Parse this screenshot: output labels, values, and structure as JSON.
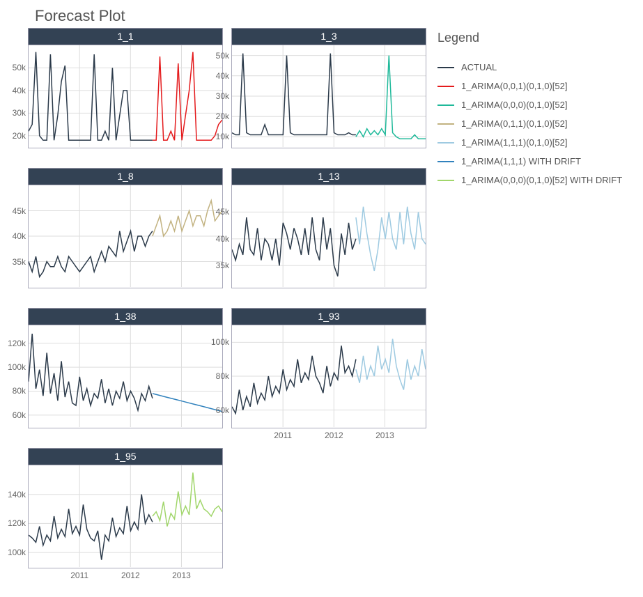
{
  "title": "Forecast Plot",
  "legend_title": "Legend",
  "legend": [
    {
      "label": "ACTUAL",
      "color": "#2b3a4a"
    },
    {
      "label": "1_ARIMA(0,0,1)(0,1,0)[52]",
      "color": "#e41a1c"
    },
    {
      "label": "1_ARIMA(0,0,0)(0,1,0)[52]",
      "color": "#1fb99a"
    },
    {
      "label": "1_ARIMA(0,1,1)(0,1,0)[52]",
      "color": "#c2b280"
    },
    {
      "label": "1_ARIMA(1,1,1)(0,1,0)[52]",
      "color": "#9ecae1"
    },
    {
      "label": "1_ARIMA(1,1,1) WITH DRIFT",
      "color": "#3182bd"
    },
    {
      "label": "1_ARIMA(0,0,0)(0,1,0)[52] WITH DRIFT",
      "color": "#a1d66b"
    }
  ],
  "x_shared": {
    "ticks": [
      "2011",
      "2012",
      "2013"
    ],
    "min": 2010,
    "max": 2013.8
  },
  "chart_data": [
    {
      "title": "1_1",
      "type": "line",
      "ylim": [
        15000,
        60000
      ],
      "yticks": [
        20000,
        30000,
        40000,
        50000
      ],
      "yticklabels": [
        "20k",
        "30k",
        "40k",
        "50k"
      ],
      "xlabel": "",
      "ylabel": "",
      "series": [
        {
          "name": "ACTUAL",
          "color": "#2b3a4a",
          "values": [
            22000,
            25000,
            57000,
            20000,
            18000,
            18000,
            56000,
            18000,
            29000,
            44000,
            51000,
            18000,
            18000,
            18000,
            18000,
            18000,
            18000,
            18000,
            56000,
            18000,
            18000,
            22000,
            18000,
            50000,
            18000,
            29000,
            40000,
            40000,
            18000,
            18000,
            18000,
            18000,
            18000,
            18000,
            18000
          ]
        },
        {
          "name": "1_ARIMA(0,0,1)(0,1,0)[52]",
          "color": "#e41a1c",
          "values": [
            18000,
            18000,
            55000,
            18000,
            18000,
            22000,
            18000,
            52000,
            18000,
            29000,
            40000,
            57000,
            18000,
            18000,
            18000,
            18000,
            18000,
            20000,
            25000,
            27000
          ]
        }
      ]
    },
    {
      "title": "1_3",
      "type": "line",
      "ylim": [
        5000,
        55000
      ],
      "yticks": [
        10000,
        20000,
        30000,
        40000,
        50000
      ],
      "yticklabels": [
        "10k",
        "20k",
        "30k",
        "40k",
        "50k"
      ],
      "xlabel": "",
      "ylabel": "",
      "series": [
        {
          "name": "ACTUAL",
          "color": "#2b3a4a",
          "values": [
            12000,
            11000,
            11000,
            51000,
            12000,
            11000,
            11000,
            11000,
            11000,
            16000,
            11000,
            11000,
            11000,
            11000,
            11000,
            50000,
            12000,
            11000,
            11000,
            11000,
            11000,
            11000,
            11000,
            11000,
            11000,
            11000,
            11000,
            51000,
            12000,
            11000,
            11000,
            11000,
            12000,
            11000,
            11000
          ]
        },
        {
          "name": "1_ARIMA(0,0,0)(0,1,0)[52]",
          "color": "#1fb99a",
          "values": [
            10000,
            13000,
            10000,
            14000,
            11000,
            13000,
            11000,
            14000,
            11000,
            50000,
            12000,
            10000,
            9000,
            9000,
            9000,
            9000,
            11000,
            9000,
            9000,
            9000
          ]
        }
      ]
    },
    {
      "title": "1_8",
      "type": "line",
      "ylim": [
        30000,
        50000
      ],
      "yticks": [
        35000,
        40000,
        45000
      ],
      "yticklabels": [
        "35k",
        "40k",
        "45k"
      ],
      "xlabel": "",
      "ylabel": "",
      "series": [
        {
          "name": "ACTUAL",
          "color": "#2b3a4a",
          "values": [
            35000,
            33000,
            36000,
            32000,
            33000,
            35000,
            34000,
            34000,
            36000,
            34000,
            33000,
            36000,
            35000,
            34000,
            33000,
            34000,
            35000,
            36000,
            33000,
            35000,
            37000,
            35000,
            38000,
            37000,
            36000,
            41000,
            37000,
            39000,
            41000,
            37000,
            40000,
            40000,
            38000,
            40000,
            41000
          ]
        },
        {
          "name": "1_ARIMA(0,1,1)(0,1,0)[52]",
          "color": "#c2b280",
          "values": [
            40000,
            42000,
            44000,
            40000,
            41000,
            43000,
            41000,
            44000,
            41000,
            43000,
            45000,
            42000,
            44000,
            44000,
            42000,
            45000,
            47000,
            43000,
            44000,
            45000
          ]
        }
      ]
    },
    {
      "title": "1_13",
      "type": "line",
      "ylim": [
        31000,
        50000
      ],
      "yticks": [
        35000,
        40000,
        45000
      ],
      "yticklabels": [
        "35k",
        "40k",
        "45k"
      ],
      "xlabel": "",
      "ylabel": "",
      "series": [
        {
          "name": "ACTUAL",
          "color": "#2b3a4a",
          "values": [
            38000,
            36000,
            39000,
            37000,
            44000,
            38000,
            37000,
            42000,
            36000,
            40000,
            39000,
            36000,
            40000,
            35000,
            43000,
            41000,
            38000,
            42000,
            40000,
            37000,
            42000,
            37000,
            44000,
            38000,
            36000,
            44000,
            38000,
            42000,
            35000,
            33000,
            41000,
            37000,
            43000,
            38000,
            40000
          ]
        },
        {
          "name": "1_ARIMA(1,1,1)(0,1,0)[52]",
          "color": "#9ecae1",
          "values": [
            44000,
            39000,
            46000,
            41000,
            37000,
            34000,
            38000,
            44000,
            40000,
            45000,
            40000,
            38000,
            45000,
            39000,
            46000,
            41000,
            38000,
            45000,
            40000,
            39000
          ]
        }
      ]
    },
    {
      "title": "1_38",
      "type": "line",
      "ylim": [
        50000,
        135000
      ],
      "yticks": [
        60000,
        80000,
        100000,
        120000
      ],
      "yticklabels": [
        "60k",
        "80k",
        "100k",
        "120k"
      ],
      "xlabel": "",
      "ylabel": "",
      "series": [
        {
          "name": "ACTUAL",
          "color": "#2b3a4a",
          "values": [
            88000,
            128000,
            82000,
            98000,
            76000,
            112000,
            78000,
            95000,
            72000,
            105000,
            75000,
            88000,
            70000,
            68000,
            92000,
            72000,
            82000,
            68000,
            78000,
            74000,
            90000,
            70000,
            82000,
            68000,
            80000,
            74000,
            88000,
            72000,
            80000,
            74000,
            64000,
            78000,
            72000,
            84000,
            74000
          ]
        },
        {
          "name": "1_ARIMA(1,1,1) WITH DRIFT",
          "color": "#3182bd",
          "values": [
            78000,
            76500,
            75000,
            73500,
            72000,
            70500,
            69000,
            67500,
            66000,
            64500,
            63000
          ]
        }
      ]
    },
    {
      "title": "1_93",
      "type": "line",
      "ylim": [
        50000,
        110000
      ],
      "yticks": [
        60000,
        80000,
        100000
      ],
      "yticklabels": [
        "60k",
        "80k",
        "100k"
      ],
      "xlabel": "",
      "ylabel": "",
      "series": [
        {
          "name": "ACTUAL",
          "color": "#2b3a4a",
          "values": [
            62000,
            58000,
            72000,
            60000,
            68000,
            62000,
            76000,
            64000,
            70000,
            66000,
            80000,
            68000,
            74000,
            70000,
            84000,
            72000,
            78000,
            74000,
            90000,
            76000,
            82000,
            78000,
            92000,
            80000,
            76000,
            70000,
            86000,
            74000,
            82000,
            78000,
            98000,
            82000,
            86000,
            80000,
            90000
          ]
        },
        {
          "name": "1_ARIMA(1,1,1)(0,1,0)[52]",
          "color": "#9ecae1",
          "values": [
            84000,
            76000,
            92000,
            78000,
            86000,
            80000,
            98000,
            84000,
            90000,
            82000,
            102000,
            86000,
            78000,
            72000,
            90000,
            78000,
            86000,
            80000,
            96000,
            84000
          ]
        }
      ]
    },
    {
      "title": "1_95",
      "type": "line",
      "ylim": [
        90000,
        160000
      ],
      "yticks": [
        100000,
        120000,
        140000
      ],
      "yticklabels": [
        "100k",
        "120k",
        "140k"
      ],
      "xlabel": "",
      "ylabel": "",
      "series": [
        {
          "name": "ACTUAL",
          "color": "#2b3a4a",
          "values": [
            112000,
            110000,
            107000,
            118000,
            105000,
            112000,
            108000,
            125000,
            110000,
            116000,
            111000,
            130000,
            113000,
            118000,
            112000,
            133000,
            116000,
            110000,
            108000,
            115000,
            95000,
            112000,
            108000,
            124000,
            111000,
            117000,
            113000,
            132000,
            115000,
            121000,
            116000,
            140000,
            120000,
            126000,
            121000
          ]
        },
        {
          "name": "1_ARIMA(0,0,0)(0,1,0)[52] WITH DRIFT",
          "color": "#a1d66b",
          "values": [
            125000,
            128000,
            122000,
            135000,
            118000,
            127000,
            123000,
            142000,
            126000,
            132000,
            126000,
            155000,
            130000,
            136000,
            130000,
            128000,
            125000,
            130000,
            132000,
            128000
          ]
        }
      ]
    }
  ]
}
